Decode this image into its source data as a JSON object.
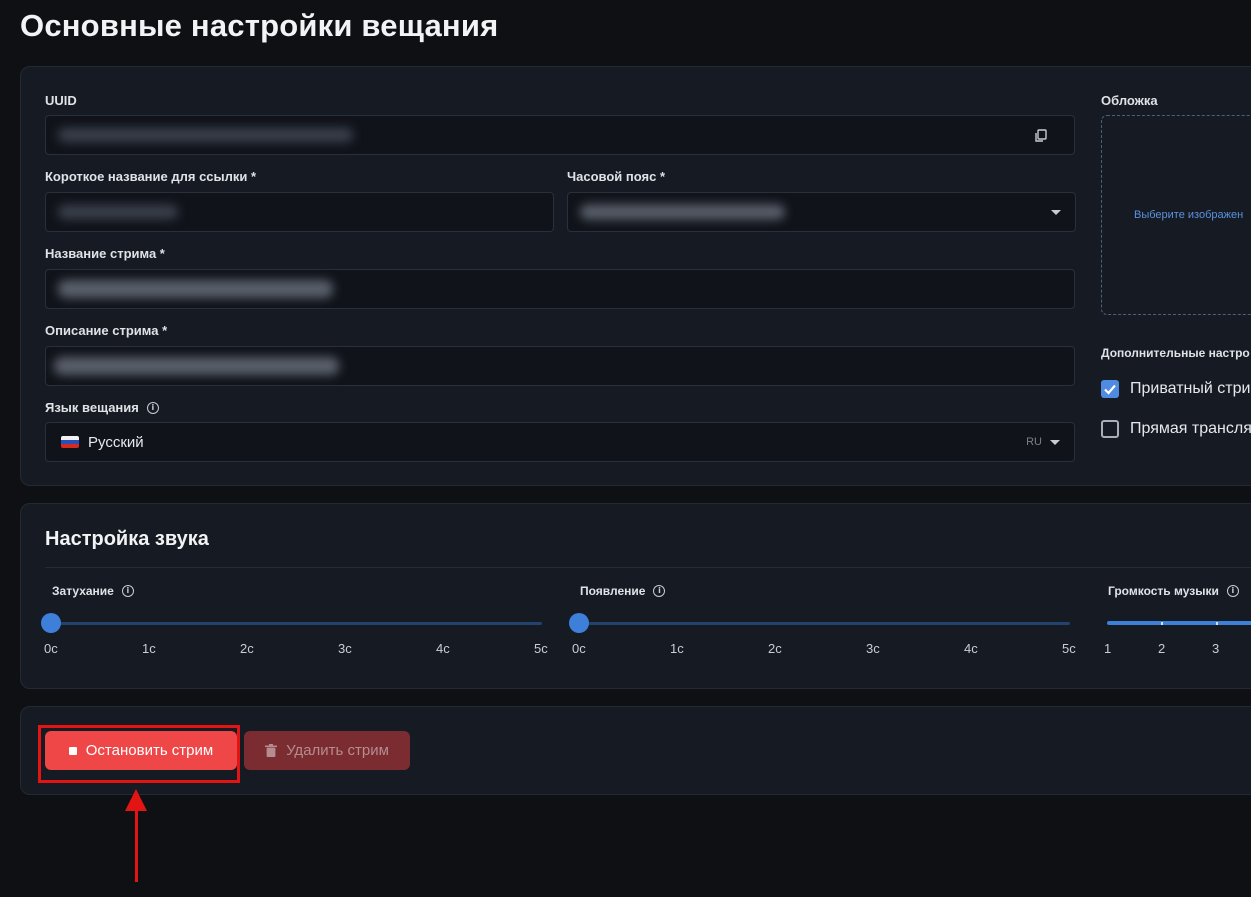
{
  "page": {
    "title": "Основные настройки вещания"
  },
  "main_settings": {
    "uuid": {
      "label": "UUID"
    },
    "short_name": {
      "label": "Короткое название для ссылки *"
    },
    "timezone": {
      "label": "Часовой пояс *"
    },
    "stream_name": {
      "label": "Название стрима *"
    },
    "stream_description": {
      "label": "Описание стрима *"
    },
    "language": {
      "label": "Язык вещания",
      "value": "Русский",
      "code": "RU"
    },
    "cover": {
      "label": "Обложка",
      "placeholder": "Выберите изображен"
    },
    "additional": {
      "label": "Дополнительные настро",
      "options": [
        {
          "label": "Приватный стри",
          "checked": true
        },
        {
          "label": "Прямая трансля",
          "checked": false
        }
      ]
    }
  },
  "sound": {
    "title": "Настройка звука",
    "sliders": [
      {
        "label": "Затухание",
        "ticks": [
          "0с",
          "1с",
          "2с",
          "3с",
          "4с",
          "5с"
        ],
        "value": 0
      },
      {
        "label": "Появление",
        "ticks": [
          "0с",
          "1с",
          "2с",
          "3с",
          "4с",
          "5с"
        ],
        "value": 0
      },
      {
        "label": "Громкость музыки",
        "ticks": [
          "1",
          "2",
          "3"
        ]
      }
    ]
  },
  "actions": {
    "stop_label": "Остановить стрим",
    "delete_label": "Удалить стрим"
  },
  "colors": {
    "accent": "#4f8be0",
    "danger": "#ef4747",
    "annotation": "#e31414"
  }
}
